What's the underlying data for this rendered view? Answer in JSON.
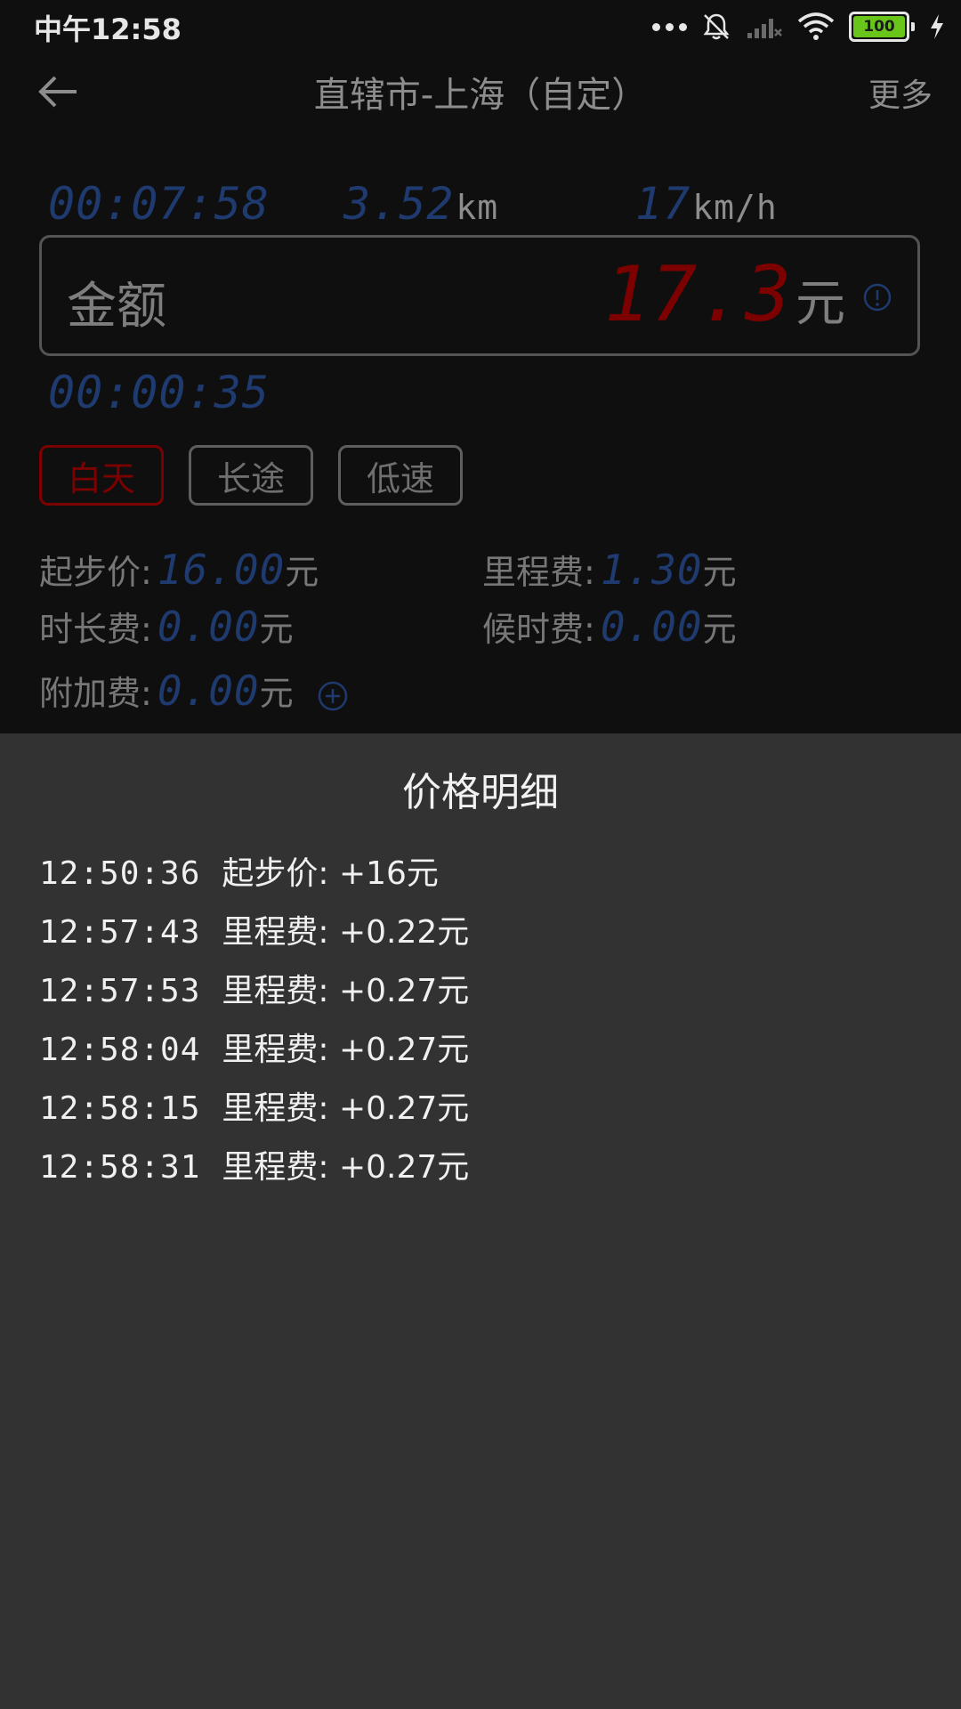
{
  "status_bar": {
    "time": "中午12:58",
    "battery": "100"
  },
  "app_bar": {
    "title": "直辖市-上海（自定）",
    "more": "更多"
  },
  "stats": {
    "elapsed": "00:07:58",
    "distance": "3.52",
    "distance_unit": "km",
    "speed": "17",
    "speed_unit": "km/h"
  },
  "amount": {
    "label": "金额",
    "value": "17.3",
    "unit": "元"
  },
  "wait_timer": "00:00:35",
  "tags": [
    {
      "label": "白天",
      "active": true
    },
    {
      "label": "长途",
      "active": false
    },
    {
      "label": "低速",
      "active": false
    }
  ],
  "fees": {
    "base": {
      "label": "起步价:",
      "value": "16.00",
      "unit": "元"
    },
    "mileage": {
      "label": "里程费:",
      "value": "1.30",
      "unit": "元"
    },
    "duration": {
      "label": "时长费:",
      "value": "0.00",
      "unit": "元"
    },
    "waiting": {
      "label": "候时费:",
      "value": "0.00",
      "unit": "元"
    },
    "extra": {
      "label": "附加费:",
      "value": "0.00",
      "unit": "元"
    }
  },
  "detail": {
    "title": "价格明细",
    "items": [
      {
        "time": "12:50:36",
        "text": "起步价: +16元"
      },
      {
        "time": "12:57:43",
        "text": "里程费: +0.22元"
      },
      {
        "time": "12:57:53",
        "text": "里程费: +0.27元"
      },
      {
        "time": "12:58:04",
        "text": "里程费: +0.27元"
      },
      {
        "time": "12:58:15",
        "text": "里程费: +0.27元"
      },
      {
        "time": "12:58:31",
        "text": "里程费: +0.27元"
      }
    ]
  },
  "colors": {
    "lcd_blue": "#1f3a6e",
    "lcd_red": "#7d0000",
    "sheet_bg": "#323232",
    "page_bg": "#0f0f10"
  }
}
